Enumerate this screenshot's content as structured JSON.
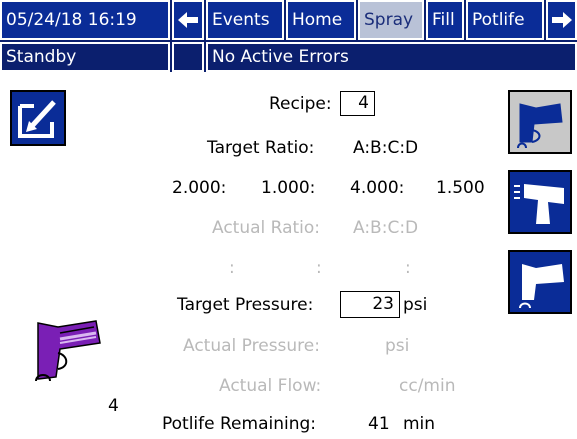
{
  "header": {
    "datetime": "05/24/18 16:19",
    "tabs": [
      "Events",
      "Home",
      "Spray",
      "Fill",
      "Potlife"
    ],
    "selected_tab": "Spray",
    "status": "Standby",
    "errors": "No Active Errors"
  },
  "main": {
    "recipe_label": "Recipe:",
    "recipe_value": "4",
    "target_ratio_label": "Target Ratio:",
    "target_ratio_value": "A:B:C:D",
    "ratio_values": [
      "2.000:",
      "1.000:",
      "4.000:",
      "1.500"
    ],
    "actual_ratio_label": "Actual Ratio:",
    "actual_ratio_value": "A:B:C:D",
    "actual_ratio_placeholders": [
      ":",
      ":",
      ":"
    ],
    "target_pressure_label": "Target Pressure:",
    "target_pressure_value": "23",
    "target_pressure_unit": "psi",
    "actual_pressure_label": "Actual Pressure:",
    "actual_pressure_unit": "psi",
    "actual_flow_label": "Actual Flow:",
    "actual_flow_unit": "cc/min",
    "potlife_label": "Potlife Remaining:",
    "potlife_value": "41",
    "potlife_unit": "min",
    "gun_number": "4"
  },
  "colors": {
    "nav_dark": "#0b1f6e",
    "nav_blue": "#0a2c97",
    "selected_tab": "#b9c2d7",
    "inactive_text": "#b9b9b9",
    "gun_purple": "#7a1fb5"
  }
}
